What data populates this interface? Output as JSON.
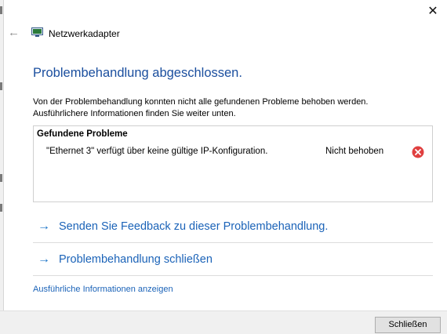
{
  "window": {
    "title": "Netzwerkadapter",
    "close_glyph": "✕",
    "back_glyph": "←"
  },
  "main": {
    "heading": "Problembehandlung abgeschlossen.",
    "description_line1": "Von der Problembehandlung konnten nicht alle gefundenen Probleme behoben werden.",
    "description_line2": "Ausführlichere Informationen finden Sie weiter unten.",
    "problems": {
      "header": "Gefundene Probleme",
      "items": [
        {
          "description": "\"Ethernet 3\" verfügt über keine gültige IP-Konfiguration.",
          "status": "Nicht behoben",
          "icon": "error-icon"
        }
      ]
    },
    "links": [
      {
        "label": "Senden Sie Feedback zu dieser Problembehandlung.",
        "arrow": "→"
      },
      {
        "label": "Problembehandlung schließen",
        "arrow": "→"
      }
    ],
    "details_link": "Ausführliche Informationen anzeigen"
  },
  "footer": {
    "close_button": "Schließen"
  },
  "colors": {
    "heading": "#1a4e9e",
    "link": "#1b63b8",
    "error": "#e04040"
  }
}
